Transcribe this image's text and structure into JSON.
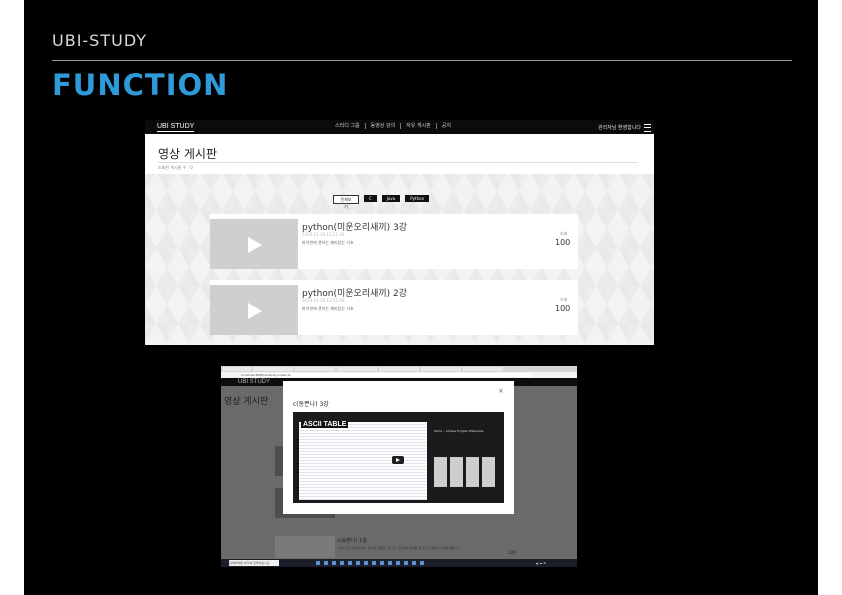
{
  "slide": {
    "brand": "UBI-STUDY",
    "title": "FUNCTION"
  },
  "screenshot1": {
    "logo": "UBI STUDY",
    "menu": [
      "스터디 그룹",
      "동영상 강의",
      "자유 게시판",
      "공지"
    ],
    "user": "관리자님 환영합니다",
    "page_title": "영상 게시판",
    "subtitle": "조회된 게시물 수 : 0",
    "filters": [
      "전체보기",
      "C",
      "Java",
      "Python"
    ],
    "cards": [
      {
        "title": "python(미운오리새끼) 3강",
        "date": "2019-11-20 13:21:48",
        "desc": "파이썬에 관하는 재미있는 기초",
        "views_label": "조회",
        "views": "100"
      },
      {
        "title": "python(미운오리새끼) 2강",
        "date": "2019-11-20 13:21:48",
        "desc": "파이썬에 관하는 재미있는 기초",
        "views_label": "조회",
        "views": "100"
      }
    ]
  },
  "screenshot2": {
    "url": "localhost:8080/ubistudy/video.do",
    "logo": "UBI STUDY",
    "page_title": "영상 게시판",
    "modal_title": "c(동쁜나) 3강",
    "close": "×",
    "video_label": "ASCII TABLE",
    "video_side_title": "ASCII -- Simple English Wikipedia",
    "card3_title": "c(동쁜나) 1강",
    "card3_desc": "C언어 기초 강좌입니다. 변수와 자료형, 연산자, 조건문과 반복문 등 프로그래밍의 기초를 배웁니다.",
    "views": "100",
    "taskbar_search": "검색하려면 여기에 입력하십시오."
  }
}
